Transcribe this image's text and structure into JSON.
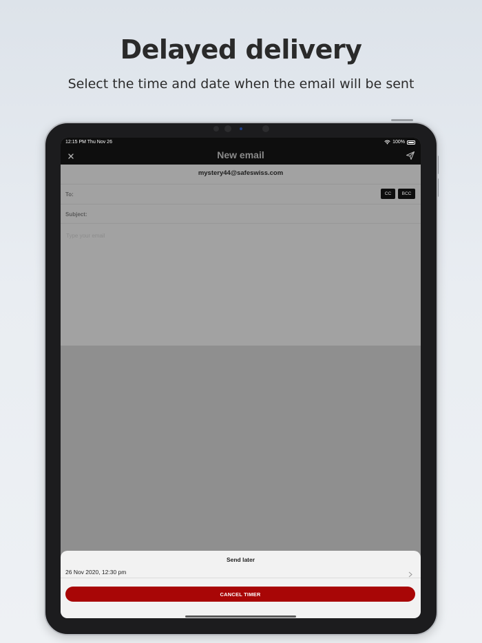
{
  "promo": {
    "headline": "Delayed delivery",
    "subline": "Select the time and date when the email will be sent"
  },
  "status_bar": {
    "time": "12:15 PM  Thu Nov 26",
    "battery": "100%"
  },
  "nav": {
    "title": "New email",
    "close_icon": "close-icon",
    "send_icon": "send-icon"
  },
  "compose": {
    "from": "mystery44@safeswiss.com",
    "to_label": "To:",
    "subject_label": "Subject:",
    "cc_label": "CC",
    "bcc_label": "BCC",
    "body_placeholder": "Type your email"
  },
  "sheet": {
    "title": "Send later",
    "scheduled_date": "26 Nov 2020, 12:30 pm",
    "cancel_label": "CANCEL TIMER"
  },
  "colors": {
    "accent": "#a80606",
    "dark_bar": "#0e0e0e",
    "overlay": "#8f8f8f"
  }
}
